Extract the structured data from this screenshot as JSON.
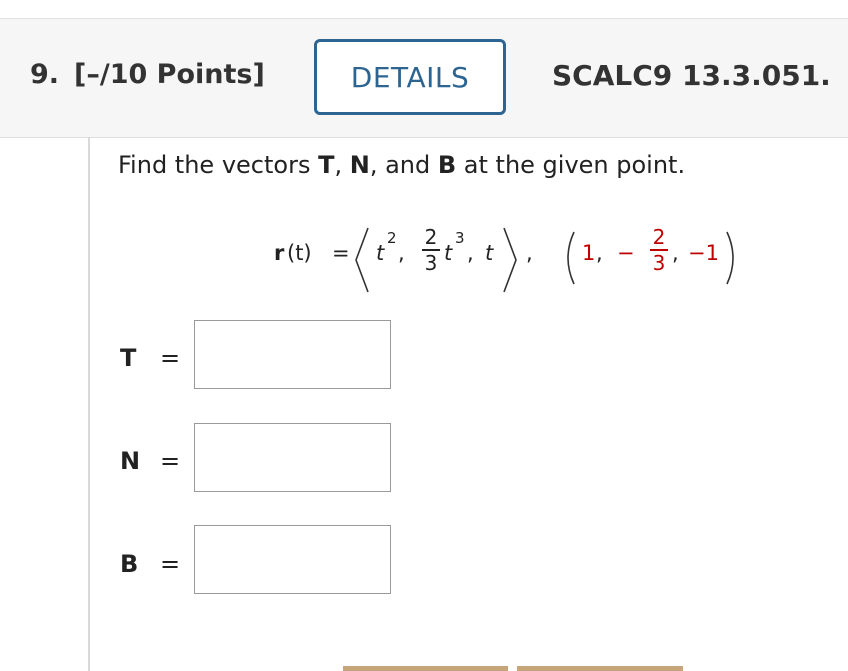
{
  "header": {
    "question_number": "9.",
    "points": "[–/10 Points]",
    "details_label": "DETAILS",
    "question_code": "SCALC9 13.3.051."
  },
  "prompt": {
    "before": "Find the vectors ",
    "T": "T",
    "sep1": ", ",
    "N": "N",
    "sep2": ", and ",
    "B": "B",
    "after": " at the given point."
  },
  "equation": {
    "func_name": "r",
    "func_arg": "(t)",
    "equals": "=",
    "c1": "t",
    "c1_exp": "2",
    "frac_num": "2",
    "frac_den": "3",
    "c2": "t",
    "c2_exp": "3",
    "c3": "t",
    "point_x": "1",
    "point_sign": "−",
    "point_frac_num": "2",
    "point_frac_den": "3",
    "point_z": "−1"
  },
  "answers": [
    {
      "label": "T",
      "equals": "=",
      "value": ""
    },
    {
      "label": "N",
      "equals": "=",
      "value": ""
    },
    {
      "label": "B",
      "equals": "=",
      "value": ""
    }
  ]
}
